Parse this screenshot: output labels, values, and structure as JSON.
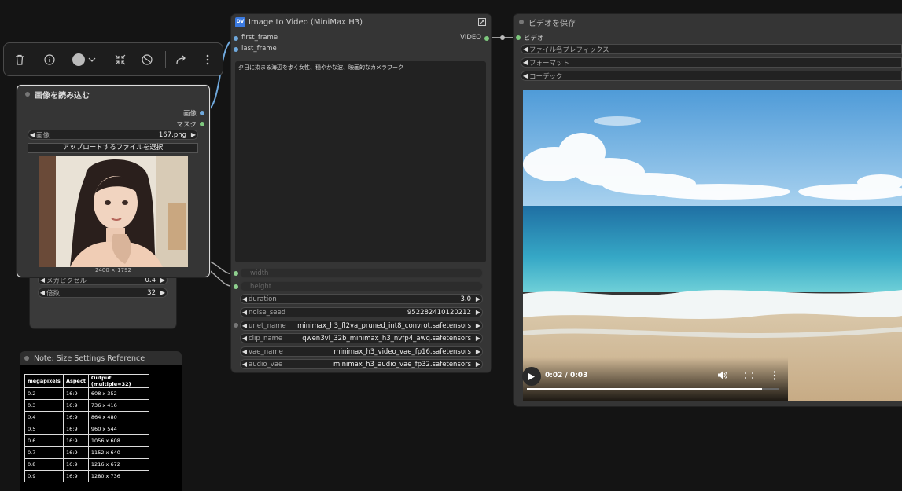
{
  "toolbar": {
    "delete_icon": "trash-icon",
    "info_icon": "info-icon",
    "color_icon": "color-circle-icon",
    "collapse_icon": "collapse-icon",
    "bypass_icon": "bypass-icon",
    "redo_icon": "redo-icon",
    "more_icon": "more-vertical-icon"
  },
  "load_image": {
    "title": "画像を読み込む",
    "outputs": [
      "画像",
      "マスク"
    ],
    "image_label": "画像",
    "image_value": "167.png",
    "upload_button": "アップロードするファイルを選択",
    "image_size": "2400 × 1792",
    "megapixels_label": "メガピクセル",
    "megapixels_value": "0.4",
    "multiple_label": "倍数",
    "multiple_value": "32"
  },
  "i2v": {
    "title": "Image to Video (MiniMax H3)",
    "inputs": [
      "first_frame",
      "last_frame"
    ],
    "output": "VIDEO",
    "prompt": "夕日に染まる海辺を歩く女性、穏やかな波、映画的なカメラワーク",
    "width_label": "width",
    "height_label": "height",
    "widgets": [
      {
        "label": "duration",
        "value": "3.0"
      },
      {
        "label": "noise_seed",
        "value": "952282410120212"
      },
      {
        "label": "unet_name",
        "value": "minimax_h3_fl2va_pruned_int8_convrot.safetensors"
      },
      {
        "label": "clip_name",
        "value": "qwen3vl_32b_minimax_h3_nvfp4_awq.safetensors"
      },
      {
        "label": "vae_name",
        "value": "minimax_h3_video_vae_fp16.safetensors"
      },
      {
        "label": "audio_vae",
        "value": "minimax_h3_audio_vae_fp32.safetensors"
      }
    ]
  },
  "save_video": {
    "title": "ビデオを保存",
    "input": "ビデオ",
    "widgets": [
      "ファイル名プレフィックス",
      "フォーマット",
      "コーデック"
    ],
    "player_time": "0:02 / 0:03",
    "progress": 0.93
  },
  "note": {
    "title": "Note: Size Settings Reference",
    "headers": [
      "megapixels",
      "Aspect",
      "Output (multiple=32)"
    ],
    "rows": [
      [
        "0.2",
        "16:9",
        "608 x 352"
      ],
      [
        "0.3",
        "16:9",
        "736 x 416"
      ],
      [
        "0.4",
        "16:9",
        "864 x 480"
      ],
      [
        "0.5",
        "16:9",
        "960 x 544"
      ],
      [
        "0.6",
        "16:9",
        "1056 x 608"
      ],
      [
        "0.7",
        "16:9",
        "1152 x 640"
      ],
      [
        "0.8",
        "16:9",
        "1216 x 672"
      ],
      [
        "0.9",
        "16:9",
        "1280 x 736"
      ]
    ]
  },
  "colors": {
    "image_link": "#6fa8dc",
    "mask_link": "#7ec97e",
    "video_link": "#9a9a9a",
    "int_link": "#8ed08e"
  }
}
